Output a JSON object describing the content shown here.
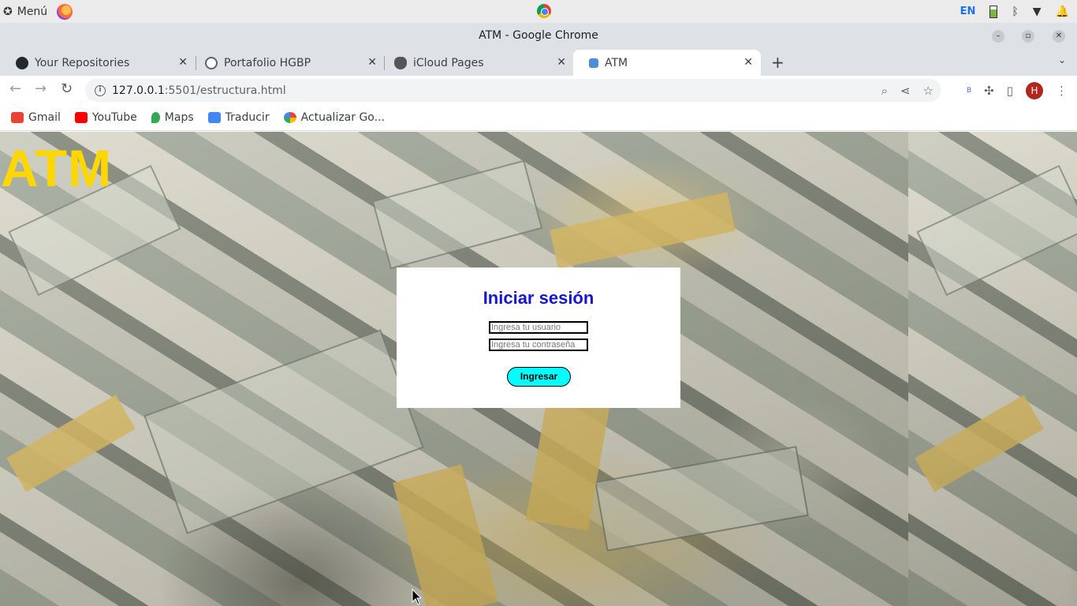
{
  "system": {
    "menu_label": "Menú",
    "lang": "EN"
  },
  "window": {
    "title": "ATM - Google Chrome"
  },
  "tabs": [
    {
      "label": "Your Repositories"
    },
    {
      "label": "Portafolio HGBP"
    },
    {
      "label": "iCloud Pages"
    },
    {
      "label": "ATM"
    }
  ],
  "address": {
    "host": "127.0.0.1",
    "rest": ":5501/estructura.html"
  },
  "profile": {
    "initial": "H"
  },
  "bookmarks": [
    {
      "label": "Gmail",
      "color": "#ea4335"
    },
    {
      "label": "YouTube",
      "color": "#ff0000"
    },
    {
      "label": "Maps",
      "color": "#34a853"
    },
    {
      "label": "Traducir",
      "color": "#4285f4"
    },
    {
      "label": "Actualizar Go...",
      "color": "#fbbc05"
    }
  ],
  "page": {
    "heading": "ATM",
    "heading_color": "#ffd700",
    "login": {
      "title": "Iniciar sesión",
      "title_color": "#1414d6",
      "username_placeholder": "Ingresa tu usuario",
      "password_placeholder": "Ingresa tu contraseña",
      "submit_label": "Ingresar",
      "submit_color": "#00ffff"
    }
  }
}
